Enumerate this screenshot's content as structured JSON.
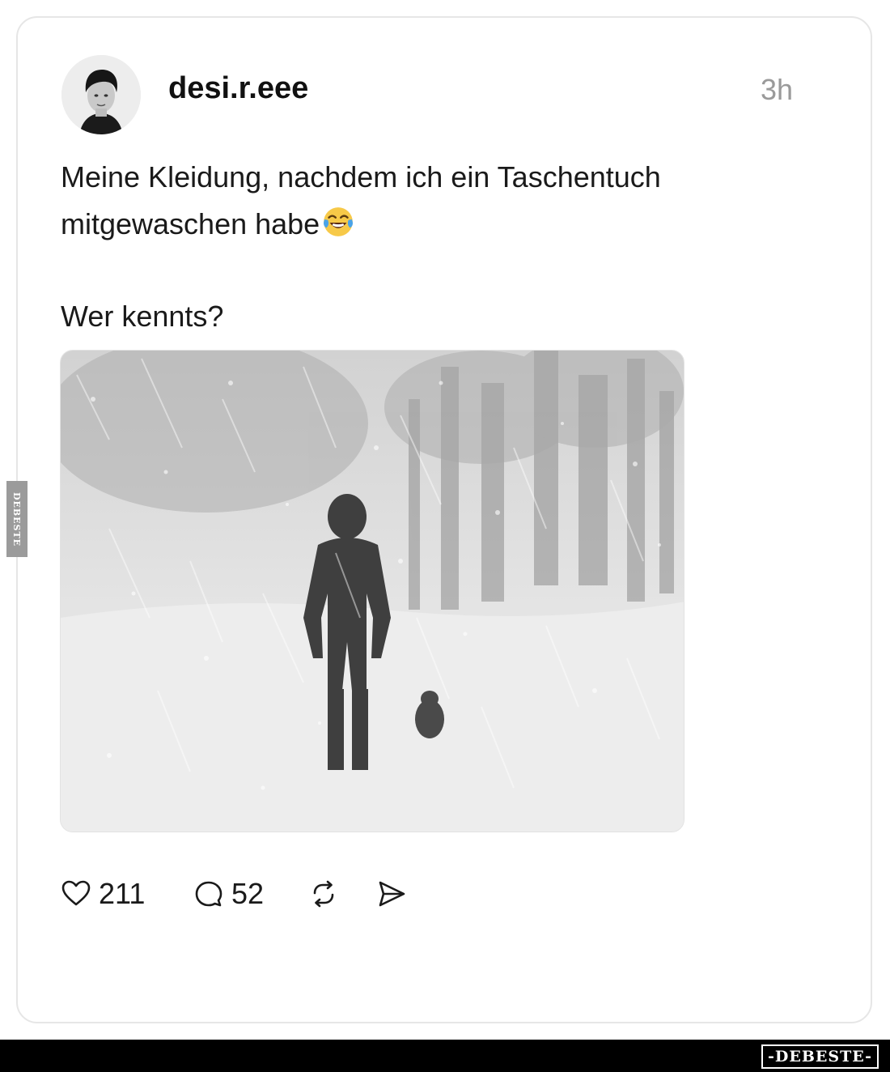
{
  "post": {
    "username": "desi.r.eee",
    "time": "3h",
    "caption_line1": "Meine Kleidung, nachdem ich ein Taschentuch",
    "caption_line2": "mitgewaschen habe",
    "caption_emoji": "face-with-tears-of-joy-icon",
    "caption_line3": "Wer kennts?",
    "image": "black-and-white photo of a person and a small dog walking in a heavy snowstorm among trees"
  },
  "actions": {
    "likes": "211",
    "comments": "52",
    "icons": [
      "heart-icon",
      "comment-icon",
      "repost-icon",
      "share-icon"
    ]
  },
  "watermark": {
    "side": "DEBESTE",
    "footer": "-DEBESTE-"
  },
  "colors": {
    "card_border": "#e6e6e6",
    "muted_text": "#9a9a9a",
    "footer_bar": "#000000"
  }
}
